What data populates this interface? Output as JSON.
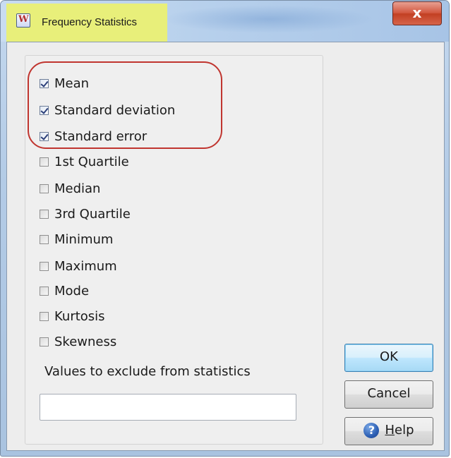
{
  "window": {
    "title": "Frequency Statistics",
    "close_glyph": "x",
    "app_icon_glyph": "W"
  },
  "options": [
    {
      "label": "Mean",
      "checked": true
    },
    {
      "label": "Standard deviation",
      "checked": true
    },
    {
      "label": "Standard error",
      "checked": true
    },
    {
      "label": "1st Quartile",
      "checked": false
    },
    {
      "label": "Median",
      "checked": false
    },
    {
      "label": "3rd Quartile",
      "checked": false
    },
    {
      "label": "Minimum",
      "checked": false
    },
    {
      "label": "Maximum",
      "checked": false
    },
    {
      "label": "Mode",
      "checked": false
    },
    {
      "label": "Kurtosis",
      "checked": false
    },
    {
      "label": "Skewness",
      "checked": false
    }
  ],
  "exclude": {
    "label": "Values to exclude from statistics",
    "value": ""
  },
  "buttons": {
    "ok": "OK",
    "cancel": "Cancel",
    "help_mnemonic": "H",
    "help_rest": "elp",
    "help_icon_glyph": "?"
  },
  "colors": {
    "highlight_oval": "#c0352f",
    "title_highlight": "#e8ef7a",
    "close_button": "#c23f22"
  }
}
